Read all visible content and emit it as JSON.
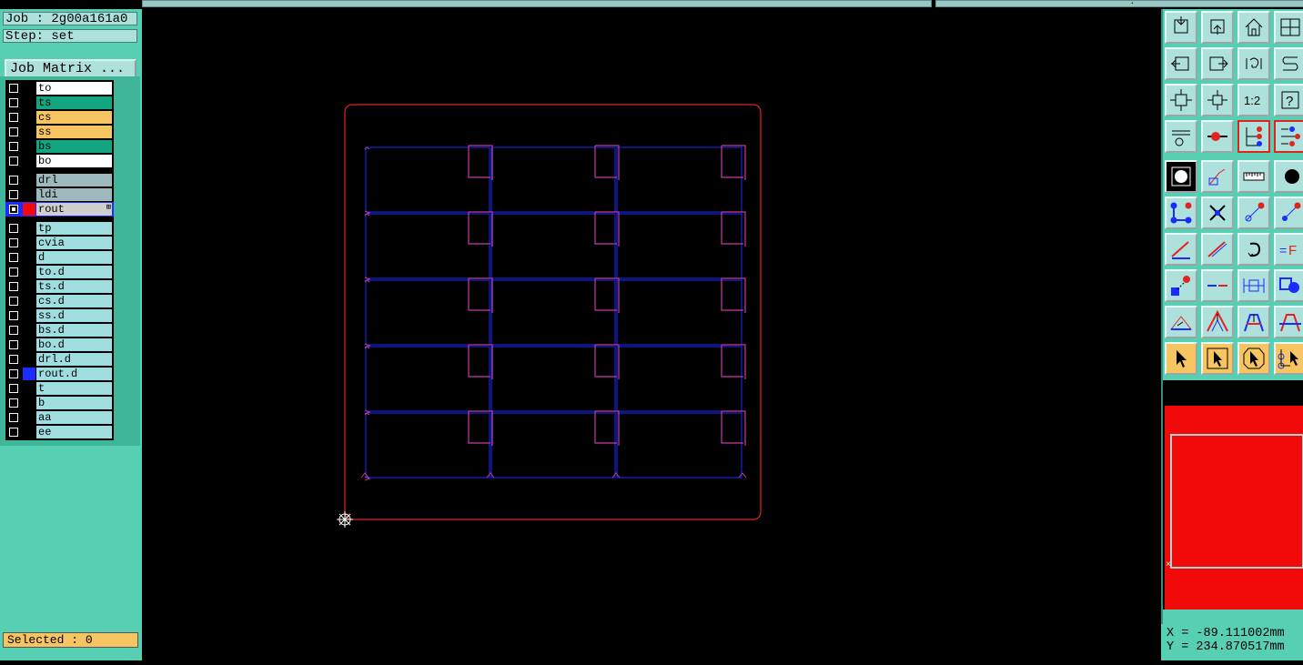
{
  "job": "Job : 2g00a161a0",
  "step": "Step: set",
  "job_matrix_label": "Job Matrix ...",
  "layers": [
    {
      "name": "to",
      "bg": "#ffffff",
      "color": "#000000",
      "active": false
    },
    {
      "name": "ts",
      "bg": "#13a57f",
      "color": "#000000",
      "active": false
    },
    {
      "name": "cs",
      "bg": "#f7c462",
      "color": "#000000",
      "active": false
    },
    {
      "name": "ss",
      "bg": "#f7c462",
      "color": "#000000",
      "active": false
    },
    {
      "name": "bs",
      "bg": "#13a57f",
      "color": "#000000",
      "active": false
    },
    {
      "name": "bo",
      "bg": "#ffffff",
      "color": "#000000",
      "active": false
    },
    {
      "sep": true
    },
    {
      "name": "drl",
      "bg": "#9db9bd",
      "color": "#000000",
      "active": false
    },
    {
      "name": "ldi",
      "bg": "#9db9bd",
      "color": "#000000",
      "active": false
    },
    {
      "name": "rout",
      "bg": "#cfcfcf",
      "color": "#f20a0a",
      "active": true
    },
    {
      "sep": true
    },
    {
      "name": "tp",
      "bg": "#9fdde0",
      "color": "#000000",
      "active": false
    },
    {
      "name": "cvia",
      "bg": "#9fdde0",
      "color": "#000000",
      "active": false
    },
    {
      "name": "d",
      "bg": "#9fdde0",
      "color": "#000000",
      "active": false
    },
    {
      "name": "to.d",
      "bg": "#9fdde0",
      "color": "#000000",
      "active": false
    },
    {
      "name": "ts.d",
      "bg": "#9fdde0",
      "color": "#000000",
      "active": false
    },
    {
      "name": "cs.d",
      "bg": "#9fdde0",
      "color": "#000000",
      "active": false
    },
    {
      "name": "ss.d",
      "bg": "#9fdde0",
      "color": "#000000",
      "active": false
    },
    {
      "name": "bs.d",
      "bg": "#9fdde0",
      "color": "#000000",
      "active": false
    },
    {
      "name": "bo.d",
      "bg": "#9fdde0",
      "color": "#000000",
      "active": false
    },
    {
      "name": "drl.d",
      "bg": "#9fdde0",
      "color": "#000000",
      "active": false
    },
    {
      "name": "rout.d",
      "bg": "#9fdde0",
      "color": "#1a2cff",
      "active": false
    },
    {
      "name": "t",
      "bg": "#9fdde0",
      "color": "#000000",
      "active": false
    },
    {
      "name": "b",
      "bg": "#9fdde0",
      "color": "#000000",
      "active": false
    },
    {
      "name": "aa",
      "bg": "#9fdde0",
      "color": "#000000",
      "active": false
    },
    {
      "name": "ee",
      "bg": "#9fdde0",
      "color": "#000000",
      "active": false
    }
  ],
  "selected": "Selected : 0",
  "coords": {
    "x": "X = -89.111002mm",
    "y": "Y = 234.870517mm"
  },
  "scale_label": "1:2",
  "colors": {
    "panel": "#56cfb3",
    "outline": "#e4231f",
    "grid": "#1a2cff",
    "rout": "#c53aa6"
  }
}
